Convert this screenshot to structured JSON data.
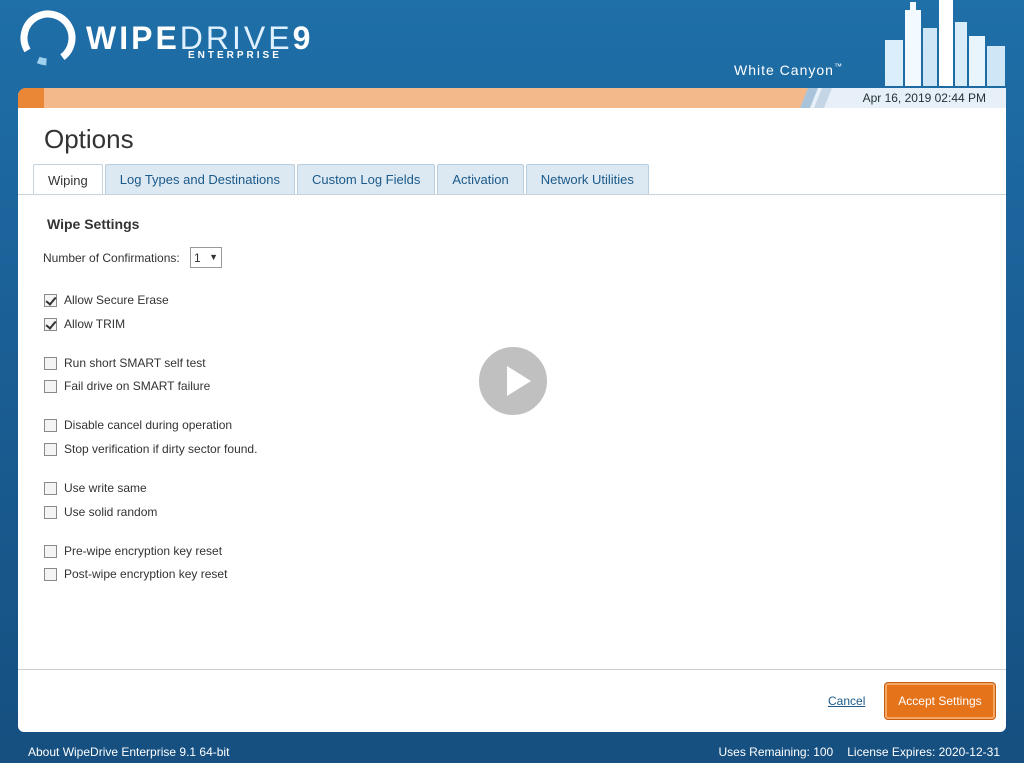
{
  "header": {
    "logo_main": "WIPE",
    "logo_light": "DRIVE",
    "logo_version": "9",
    "logo_sub": "ENTERPRISE",
    "brand": "White Canyon",
    "brand_tm": "™",
    "icon": "wipedrive-ring-logo-icon",
    "skyline_icon": "city-skyline-icon"
  },
  "status_strip": {
    "datetime": "Apr 16, 2019 02:44 PM",
    "accent": "#e98736"
  },
  "page": {
    "title": "Options"
  },
  "tabs": [
    {
      "label": "Wiping",
      "active": true
    },
    {
      "label": "Log Types and Destinations",
      "active": false
    },
    {
      "label": "Custom Log Fields",
      "active": false
    },
    {
      "label": "Activation",
      "active": false
    },
    {
      "label": "Network Utilities",
      "active": false
    }
  ],
  "wipe_settings": {
    "title": "Wipe Settings",
    "confirmations_label": "Number of Confirmations:",
    "confirmations_value": "1",
    "options": [
      {
        "label": "Allow Secure Erase",
        "checked": true
      },
      {
        "label": "Allow TRIM",
        "checked": true
      },
      {
        "label": "Run short SMART self test",
        "checked": false
      },
      {
        "label": "Fail drive on SMART failure",
        "checked": false
      },
      {
        "label": "Disable cancel during operation",
        "checked": false
      },
      {
        "label": "Stop verification if dirty sector found.",
        "checked": false
      },
      {
        "label": "Use write same",
        "checked": false
      },
      {
        "label": "Use solid random",
        "checked": false
      },
      {
        "label": "Pre-wipe encryption key reset",
        "checked": false
      },
      {
        "label": "Post-wipe encryption key reset",
        "checked": false
      }
    ]
  },
  "actions": {
    "cancel": "Cancel",
    "accept": "Accept Settings",
    "accept_color": "#e5731a"
  },
  "overlay": {
    "icon": "play-icon"
  },
  "footer": {
    "about": "About WipeDrive Enterprise 9.1 64-bit",
    "uses": "Uses Remaining: 100",
    "license": "License Expires: 2020-12-31"
  }
}
